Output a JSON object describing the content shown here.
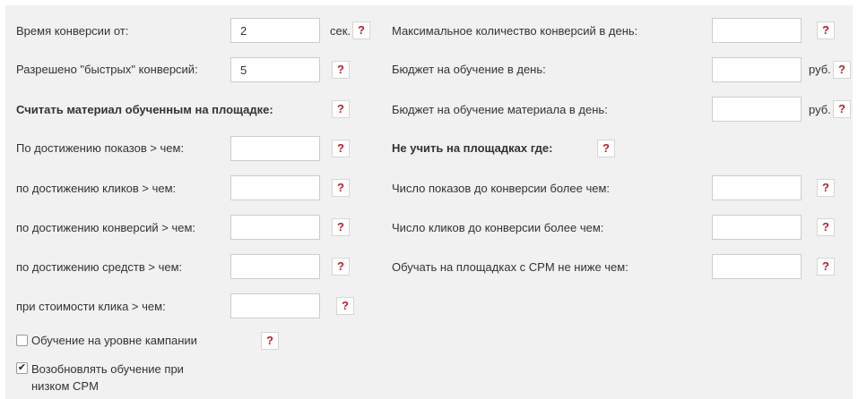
{
  "help_icon": "?",
  "left": {
    "conversion_time": {
      "label": "Время конверсии от:",
      "value": "2",
      "unit": "сек."
    },
    "fast_conversions": {
      "label": "Разрешено \"быстрых\" конверсий:",
      "value": "5"
    },
    "trained_heading": "Считать материал обученным на площадке:",
    "by_impressions": {
      "label": "По достижению показов > чем:",
      "value": ""
    },
    "by_clicks": {
      "label": "по достижению кликов > чем:",
      "value": ""
    },
    "by_conversions": {
      "label": "по достижению конверсий > чем:",
      "value": ""
    },
    "by_funds": {
      "label": "по достижению средств > чем:",
      "value": ""
    },
    "by_click_cost": {
      "label": "при стоимости клика > чем:",
      "value": ""
    },
    "campaign_level": {
      "label": "Обучение на уровне кампании",
      "checked": false
    },
    "resume_low_cpm": {
      "label_line1": "Возобновлять обучение при",
      "label_line2": "низком CPM",
      "checked": true
    }
  },
  "right": {
    "max_conversions": {
      "label": "Максимальное количество конверсий в день:",
      "value": ""
    },
    "training_budget": {
      "label": "Бюджет на обучение в день:",
      "value": "",
      "unit": "руб."
    },
    "material_budget": {
      "label": "Бюджет на обучение материала в день:",
      "value": "",
      "unit": "руб."
    },
    "no_train_heading": "Не учить на площадках где:",
    "impressions_before": {
      "label": "Число показов до конверсии более чем:",
      "value": ""
    },
    "clicks_before": {
      "label": "Число кликов до конверсии более чем:",
      "value": ""
    },
    "cpm_min": {
      "label": "Обучать на площадках с CPM не ниже чем:",
      "value": ""
    }
  }
}
